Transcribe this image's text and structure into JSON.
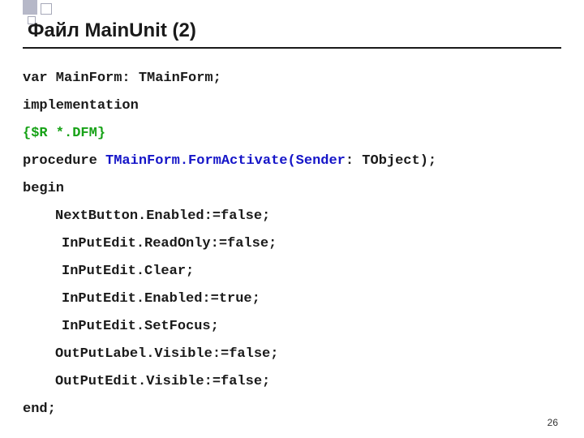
{
  "title": "Файл MainUnit (2)",
  "pageNumber": "26",
  "code": {
    "l1": "var MainForm: TMainForm;",
    "l2": "implementation",
    "l3": "{$R *.DFM}",
    "l4a": "procedure ",
    "l4b": "TMainForm.FormActivate(Sender",
    "l4c": ": TObject);",
    "l5": "begin",
    "l6": "NextButton.Enabled:=false;",
    "l7": "InPutEdit.ReadOnly:=false;",
    "l8": "InPutEdit.Clear;",
    "l9": "InPutEdit.Enabled:=true;",
    "l10": "InPutEdit.SetFocus;",
    "l11": "OutPutLabel.Visible:=false;",
    "l12": "OutPutEdit.Visible:=false;",
    "l13": "end;"
  }
}
